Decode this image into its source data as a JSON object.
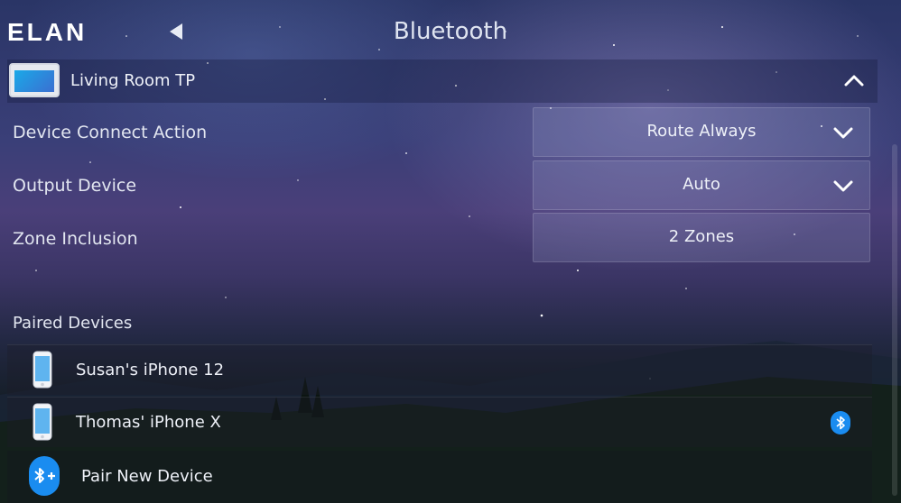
{
  "header": {
    "logo": "ELAN",
    "title": "Bluetooth"
  },
  "device": {
    "name": "Living Room TP"
  },
  "settings": [
    {
      "label": "Device Connect Action",
      "value": "Route Always",
      "dropdown": true
    },
    {
      "label": "Output Device",
      "value": "Auto",
      "dropdown": true
    },
    {
      "label": "Zone Inclusion",
      "value": "2 Zones",
      "dropdown": false
    }
  ],
  "paired_section": {
    "title": "Paired Devices"
  },
  "paired_devices": [
    {
      "name": "Susan's iPhone 12",
      "connected": false
    },
    {
      "name": "Thomas' iPhone X",
      "connected": true
    }
  ],
  "pair_new": {
    "label": "Pair New Device"
  },
  "colors": {
    "accent_blue": "#1a8cf0",
    "text": "#eef1f8"
  },
  "icons": {
    "back": "back-arrow-icon",
    "collapse": "chevron-up-icon",
    "dropdown": "chevron-down-icon",
    "phone": "phone-icon",
    "bluetooth": "bluetooth-icon",
    "bluetooth_add": "bluetooth-add-icon",
    "touchpanel": "touchpanel-icon"
  }
}
